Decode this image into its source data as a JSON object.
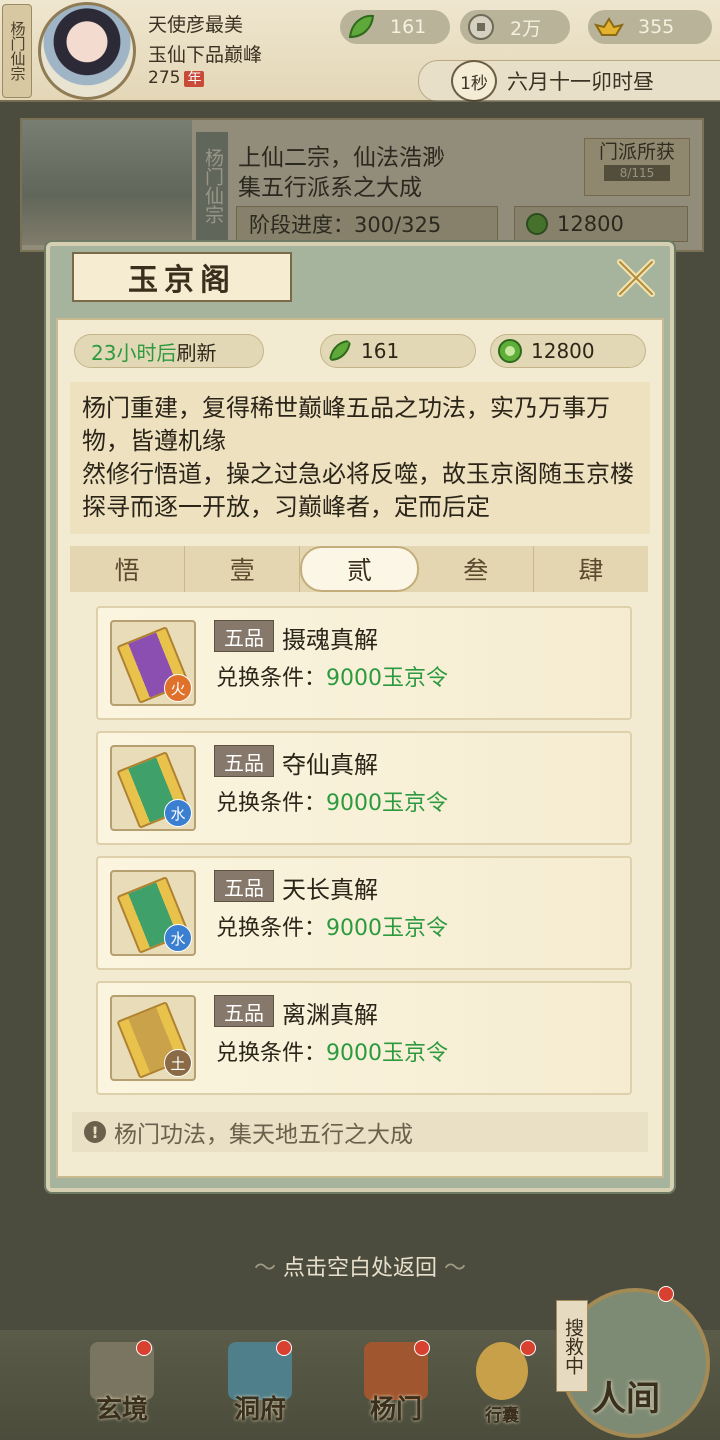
{
  "top": {
    "sect_tag": "杨门仙宗",
    "player_name": "天使彦最美",
    "rank": "玉仙下品巅峰",
    "age": "275",
    "age_unit": "年",
    "resources": [
      {
        "icon": "jade-leaf-icon",
        "value": "161"
      },
      {
        "icon": "coin-icon",
        "value": "2万"
      },
      {
        "icon": "gold-ingot-icon",
        "value": "355"
      }
    ],
    "time_speed": "1秒",
    "time_text": "六月十一卯时昼"
  },
  "sect_card": {
    "vertical_name": "杨门仙宗",
    "line1": "上仙二宗，仙法浩渺",
    "line2": "集五行派系之大成",
    "progress": "阶段进度：300/325",
    "token_value": "12800",
    "gain_label": "门派所获",
    "gain_count": "8/115"
  },
  "dialog": {
    "title": "玉京阁",
    "close_icon": "close-icon",
    "refresh_time": "23小时后",
    "refresh_suffix": "刷新",
    "currency1": "161",
    "currency2": "12800",
    "description": "杨门重建，复得稀世巅峰五品之功法，实乃万事万物，皆遵机缘\n然修行悟道，操之过急必将反噬，故玉京阁随玉京楼探寻而逐一开放，习巅峰者，定而后定",
    "tabs": [
      {
        "label": "悟",
        "active": false
      },
      {
        "label": "壹",
        "active": false
      },
      {
        "label": "贰",
        "active": true
      },
      {
        "label": "叁",
        "active": false
      },
      {
        "label": "肆",
        "active": false
      }
    ],
    "items": [
      {
        "grade": "五品",
        "name": "摄魂真解",
        "cond_label": "兑换条件：",
        "cond_value": "9000玉京令",
        "element": "火",
        "element_color": "#e0712a",
        "book_color": "#8a4fb0"
      },
      {
        "grade": "五品",
        "name": "夺仙真解",
        "cond_label": "兑换条件：",
        "cond_value": "9000玉京令",
        "element": "水",
        "element_color": "#3b7fd0",
        "book_color": "#3fa06a"
      },
      {
        "grade": "五品",
        "name": "天长真解",
        "cond_label": "兑换条件：",
        "cond_value": "9000玉京令",
        "element": "水",
        "element_color": "#3b7fd0",
        "book_color": "#3fa06a"
      },
      {
        "grade": "五品",
        "name": "离渊真解",
        "cond_label": "兑换条件：",
        "cond_value": "9000玉京令",
        "element": "土",
        "element_color": "#8a6b46",
        "book_color": "#c9a24a"
      }
    ],
    "tip": "杨门功法，集天地五行之大成"
  },
  "return_text": "点击空白处返回",
  "bottom_nav": [
    {
      "label": "玄境",
      "badge": true
    },
    {
      "label": "洞府",
      "badge": true
    },
    {
      "label": "杨门",
      "badge": true
    },
    {
      "label": "行囊",
      "badge": true
    }
  ],
  "renjian": {
    "label": "人间",
    "search": "搜救中"
  }
}
